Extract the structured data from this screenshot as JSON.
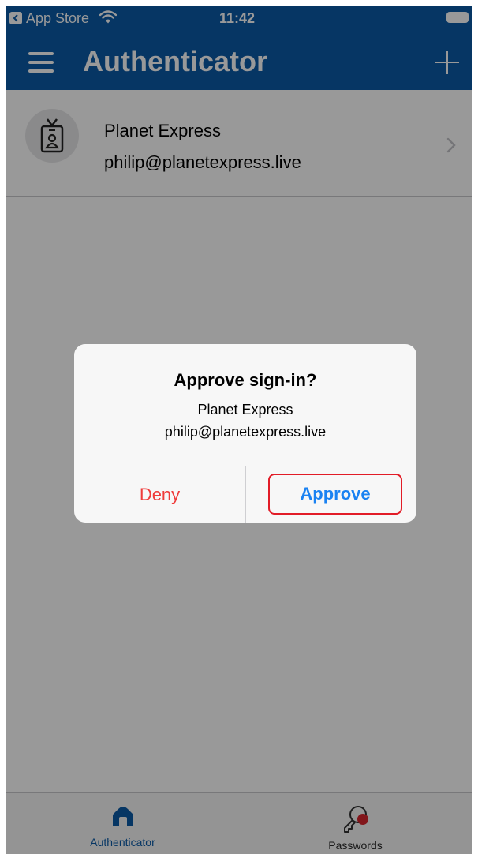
{
  "status_bar": {
    "back_label": "App Store",
    "time": "11:42"
  },
  "nav_bar": {
    "title": "Authenticator"
  },
  "account": {
    "name": "Planet Express",
    "email": "philip@planetexpress.live"
  },
  "alert": {
    "title": "Approve sign-in?",
    "message_name": "Planet Express",
    "message_email": "philip@planetexpress.live",
    "deny_label": "Deny",
    "approve_label": "Approve"
  },
  "tab_bar": {
    "tabs": [
      {
        "label": "Authenticator",
        "icon": "home-icon",
        "selected": true
      },
      {
        "label": "Passwords",
        "icon": "key-icon",
        "selected": false
      }
    ]
  },
  "colors": {
    "brand_blue": "#0a5aa7",
    "deny_red": "#ef3b3a",
    "approve_blue": "#1a82f2",
    "highlight_red": "#e21c27",
    "badge_red": "#d9262e"
  }
}
